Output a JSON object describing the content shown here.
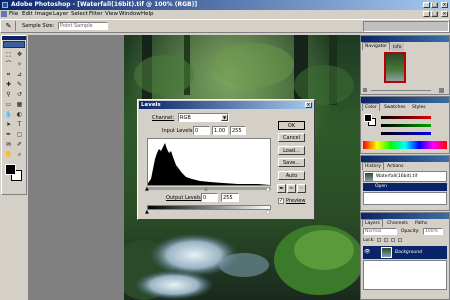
{
  "app": {
    "title": "Adobe Photoshop - [Waterfall(16bit).tif @ 100% (RGB)]",
    "window_controls": [
      "_",
      "□",
      "×"
    ],
    "doc_controls": [
      "_",
      "□",
      "×"
    ]
  },
  "menu": {
    "items": [
      "File",
      "Edit",
      "Image",
      "Layer",
      "Select",
      "Filter",
      "View",
      "Window",
      "Help"
    ]
  },
  "options_bar": {
    "sample_size_label": "Sample Size:",
    "sample_size_value": "Point Sample"
  },
  "levels": {
    "title": "Levels",
    "channel_label": "Channel:",
    "channel_value": "RGB",
    "input_label": "Input Levels:",
    "input_values": [
      "0",
      "1.00",
      "255"
    ],
    "output_label": "Output Levels:",
    "output_values": [
      "0",
      "255"
    ],
    "buttons": {
      "ok": "OK",
      "cancel": "Cancel",
      "load": "Load...",
      "save": "Save...",
      "auto": "Auto"
    },
    "preview_label": "Preview",
    "preview_checked": true
  },
  "panels": {
    "navigator": {
      "tab1": "Navigator",
      "tab2": "Info"
    },
    "color": {
      "tab1": "Color",
      "tab2": "Swatches",
      "tab3": "Styles"
    },
    "history": {
      "tab1": "History",
      "tab2": "Actions",
      "snapshot_label": "Waterfall(16bit).tif",
      "step_label": "Open"
    },
    "layers": {
      "tab1": "Layers",
      "tab2": "Channels",
      "tab3": "Paths",
      "blend_mode": "Normal",
      "opacity_label": "Opacity:",
      "opacity_value": "100%",
      "lock_label": "Lock:",
      "layer_name": "Background"
    }
  },
  "colors": {
    "title_active": "#0a246a",
    "title_grad_end": "#3a6ea5",
    "chrome": "#d4d0c8",
    "history_selected": "#0a246a",
    "slider_red": "#e00000",
    "slider_green": "#00a000",
    "slider_blue": "#0000e0"
  }
}
